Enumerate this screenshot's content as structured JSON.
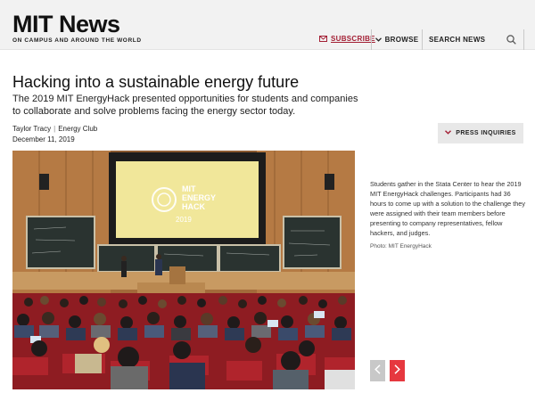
{
  "header": {
    "logo": "MIT News",
    "tagline": "ON CAMPUS AND AROUND THE WORLD",
    "subscribe_label": "SUBSCRIBE",
    "browse_label": "BROWSE",
    "search_placeholder": "SEARCH NEWS"
  },
  "article": {
    "headline": "Hacking into a sustainable energy future",
    "subhead": "The 2019 MIT EnergyHack presented opportunities for students and companies to collaborate and solve problems facing the energy sector today.",
    "author": "Taylor Tracy",
    "byline_separator": "|",
    "affiliation": "Energy Club",
    "date": "December 11, 2019",
    "press_label": "PRESS INQUIRIES"
  },
  "photo": {
    "screen_text_line1": "MIT",
    "screen_text_line2": "ENERGY",
    "screen_text_line3": "HACK",
    "screen_text_line4": "2019",
    "caption": "Students gather in the Stata Center to hear the 2019 MIT EnergyHack challenges. Participants had 36 hours to come up with a solution to the challenge they were assigned with their team members before presenting to company representatives, fellow hackers, and judges.",
    "credit": "Photo: MIT EnergyHack"
  },
  "colors": {
    "accent": "#a31f34",
    "next_button": "#e6383f",
    "prev_button": "#c8c8c8"
  }
}
